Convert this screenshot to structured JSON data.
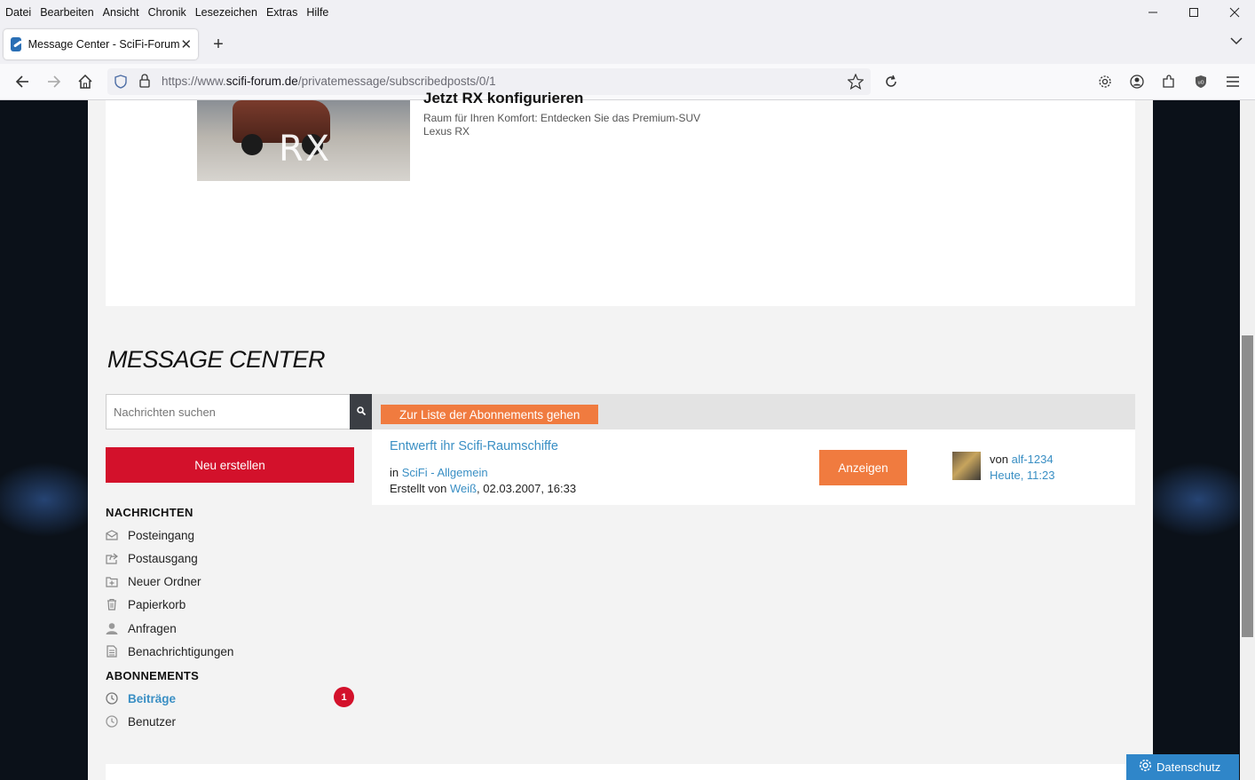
{
  "browser": {
    "menu": [
      "Datei",
      "Bearbeiten",
      "Ansicht",
      "Chronik",
      "Lesezeichen",
      "Extras",
      "Hilfe"
    ],
    "tab_title": "Message Center - SciFi-Forum",
    "url_prefix": "https://www.",
    "url_domain": "scifi-forum.de",
    "url_path": "/privatemessage/subscribedposts/0/1"
  },
  "ad": {
    "headline": "Jetzt RX konfigurieren",
    "text_line1": "Raum für Ihren Komfort: Entdecken Sie das Premium-SUV",
    "text_line2": "Lexus RX",
    "image_text": "RX"
  },
  "page": {
    "title": "MESSAGE CENTER",
    "search_placeholder": "Nachrichten suchen",
    "new_button": "Neu erstellen"
  },
  "sidebar": {
    "nachrichten_title": "NACHRICHTEN",
    "nachrichten": [
      {
        "label": "Posteingang",
        "icon": "inbox-icon"
      },
      {
        "label": "Postausgang",
        "icon": "outbox-icon"
      },
      {
        "label": "Neuer Ordner",
        "icon": "new-folder-icon"
      },
      {
        "label": "Papierkorb",
        "icon": "trash-icon"
      },
      {
        "label": "Anfragen",
        "icon": "user-icon"
      },
      {
        "label": "Benachrichtigungen",
        "icon": "document-icon"
      }
    ],
    "abonnements_title": "ABONNEMENTS",
    "abonnements": [
      {
        "label": "Beiträge",
        "icon": "clock-icon",
        "badge": "1"
      },
      {
        "label": "Benutzer",
        "icon": "clock-icon"
      }
    ]
  },
  "main": {
    "goto_button": "Zur Liste der Abonnements gehen",
    "post": {
      "title": "Entwerft ihr Scifi-Raumschiffe",
      "in_label": "in",
      "forum": "SciFi - Allgemein",
      "created_label": "Erstellt von",
      "author": "Weiß",
      "created_date": ", 02.03.2007, 16:33",
      "show_button": "Anzeigen",
      "von_label": "von",
      "last_user": "alf-1234",
      "last_time": "Heute, 11:23"
    }
  },
  "privacy_label": "Datenschutz",
  "colors": {
    "accent_red": "#d3112b",
    "accent_orange": "#f07b3f",
    "link_blue": "#3a8fc4",
    "privacy_blue": "#2f86c9"
  }
}
